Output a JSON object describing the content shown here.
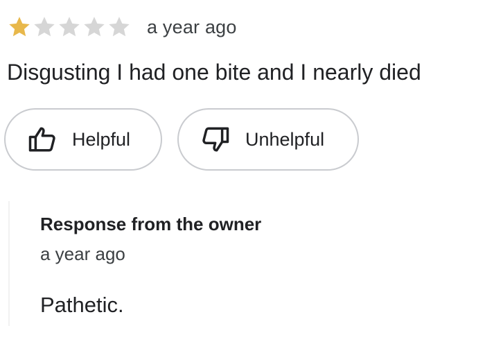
{
  "review": {
    "rating": 1,
    "max_rating": 5,
    "date": "a year ago",
    "text": "Disgusting I had one bite and I nearly died",
    "colors": {
      "star_filled": "#E8B84B",
      "star_empty": "#D6D6D6"
    }
  },
  "actions": {
    "helpful_label": "Helpful",
    "helpful_icon": "thumbs-up-icon",
    "unhelpful_label": "Unhelpful",
    "unhelpful_icon": "thumbs-down-icon"
  },
  "owner_response": {
    "title": "Response from the owner",
    "date": "a year ago",
    "text": "Pathetic."
  }
}
